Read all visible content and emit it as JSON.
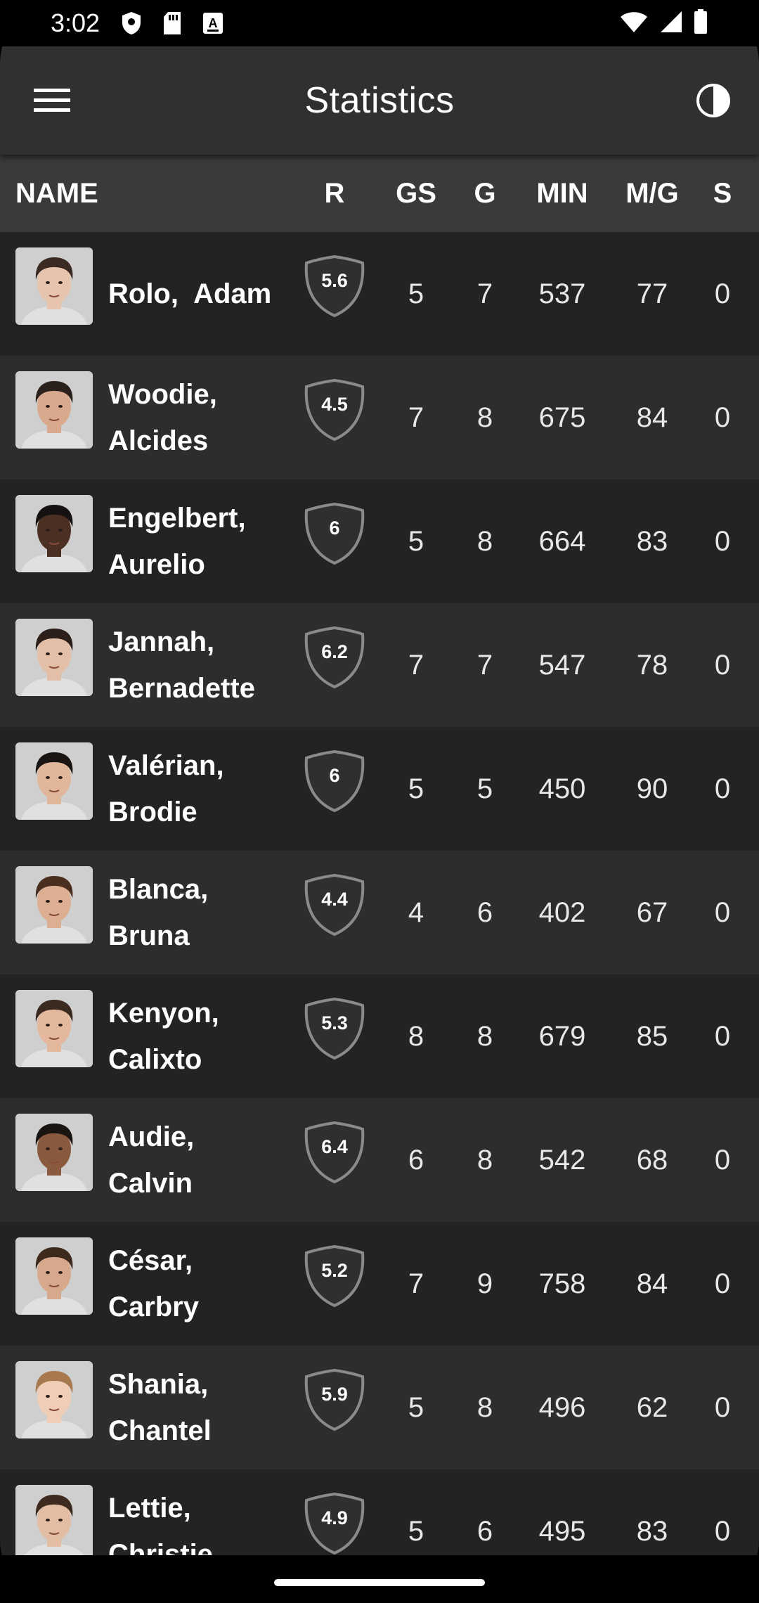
{
  "status_bar": {
    "time": "3:02",
    "icons": [
      "shield-icon",
      "sd-card-icon",
      "keyboard-a-icon"
    ],
    "right_icons": [
      "wifi-icon",
      "signal-icon",
      "battery-icon"
    ]
  },
  "app_bar": {
    "title": "Statistics",
    "menu_icon": "hamburger-menu-icon",
    "theme_icon": "contrast-toggle-icon"
  },
  "table": {
    "columns": [
      "NAME",
      "R",
      "GS",
      "G",
      "MIN",
      "M/G",
      "S"
    ],
    "rows": [
      {
        "last": "Rolo,",
        "first": "Adam",
        "single_line": true,
        "rating": "5.6",
        "gs": "5",
        "g": "7",
        "min": "537",
        "mg": "77",
        "s": "0",
        "skin": "#e7c4ae",
        "hair": "#3b2a22"
      },
      {
        "last": "Woodie,",
        "first": "Alcides",
        "single_line": false,
        "rating": "4.5",
        "gs": "7",
        "g": "8",
        "min": "675",
        "mg": "84",
        "s": "0",
        "skin": "#d9a98d",
        "hair": "#2a211c"
      },
      {
        "last": "Engelbert,",
        "first": "Aurelio",
        "single_line": false,
        "rating": "6",
        "gs": "5",
        "g": "8",
        "min": "664",
        "mg": "83",
        "s": "0",
        "skin": "#4a2f22",
        "hair": "#151110"
      },
      {
        "last": "Jannah,",
        "first": "Bernadette",
        "single_line": false,
        "rating": "6.2",
        "gs": "7",
        "g": "7",
        "min": "547",
        "mg": "78",
        "s": "0",
        "skin": "#e4bfa7",
        "hair": "#2c1f19"
      },
      {
        "last": "Valérian,",
        "first": "Brodie",
        "single_line": false,
        "rating": "6",
        "gs": "5",
        "g": "5",
        "min": "450",
        "mg": "90",
        "s": "0",
        "skin": "#e1b79c",
        "hair": "#1a1412"
      },
      {
        "last": "Blanca,",
        "first": "Bruna",
        "single_line": false,
        "rating": "4.4",
        "gs": "4",
        "g": "6",
        "min": "402",
        "mg": "67",
        "s": "0",
        "skin": "#dcae92",
        "hair": "#4a2f20"
      },
      {
        "last": "Kenyon,",
        "first": "Calixto",
        "single_line": false,
        "rating": "5.3",
        "gs": "8",
        "g": "8",
        "min": "679",
        "mg": "85",
        "s": "0",
        "skin": "#e3b89c",
        "hair": "#3a2a20"
      },
      {
        "last": "Audie,",
        "first": "Calvin",
        "single_line": false,
        "rating": "6.4",
        "gs": "6",
        "g": "8",
        "min": "542",
        "mg": "68",
        "s": "0",
        "skin": "#8a5a3f",
        "hair": "#1b1512"
      },
      {
        "last": "César,",
        "first": "Carbry",
        "single_line": false,
        "rating": "5.2",
        "gs": "7",
        "g": "9",
        "min": "758",
        "mg": "84",
        "s": "0",
        "skin": "#d6a98c",
        "hair": "#3d2a1c"
      },
      {
        "last": "Shania,",
        "first": "Chantel",
        "single_line": false,
        "rating": "5.9",
        "gs": "5",
        "g": "8",
        "min": "496",
        "mg": "62",
        "s": "0",
        "skin": "#efcdb6",
        "hair": "#a8794e"
      },
      {
        "last": "Lettie,",
        "first": "Christie",
        "single_line": false,
        "rating": "4.9",
        "gs": "5",
        "g": "6",
        "min": "495",
        "mg": "83",
        "s": "0",
        "skin": "#e3bda3",
        "hair": "#3d2b1f"
      }
    ]
  },
  "colors": {
    "appbar": "#303030",
    "header": "#3a3a3a",
    "row_dark": "#232323",
    "row_light": "#2d2d2d",
    "shield_stroke": "#8a8a8a"
  }
}
